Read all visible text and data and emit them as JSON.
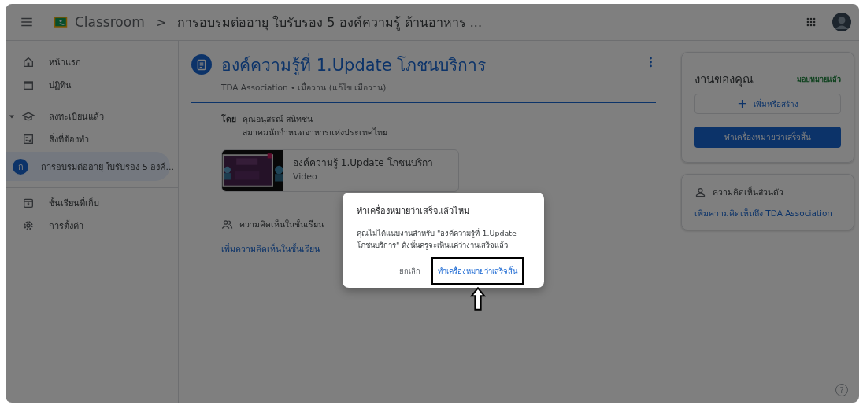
{
  "header": {
    "app_name": "Classroom",
    "separator": ">",
    "course_title": "การอบรมต่ออายุ ใบรับรอง 5 องค์ความรู้ ด้านอาหาร ..."
  },
  "sidebar": {
    "groups": [
      [
        {
          "kind": "home",
          "label": "หน้าแรก",
          "selected": false
        },
        {
          "kind": "calendar",
          "label": "ปฏิทิน",
          "selected": false
        }
      ],
      [
        {
          "kind": "enrolled",
          "label": "ลงทะเบียนแล้ว",
          "selected": false,
          "expanded": true
        },
        {
          "kind": "todo",
          "label": "สิ่งที่ต้องทำ",
          "selected": false
        },
        {
          "kind": "course",
          "label": "การอบรมต่ออายุ ใบรับรอง 5 องค์...",
          "letter": "ก",
          "selected": true
        }
      ],
      [
        {
          "kind": "archive",
          "label": "ชั้นเรียนที่เก็บ",
          "selected": false
        },
        {
          "kind": "settings",
          "label": "การตั้งค่า",
          "selected": false
        }
      ]
    ]
  },
  "post": {
    "title": "องค์ความรู้ที่ 1.Update โภชนบริการ",
    "meta": "TDA Association • เมื่อวาน (แก้ไข เมื่อวาน)",
    "author_label": "โดย",
    "author_name": "คุณอนุสรณ์ สนิทชน",
    "author_org": "สมาคมนักกำหนดอาหารแห่งประเทศไทย",
    "attachment": {
      "title": "องค์ความรู้ 1.Update โภชนบริกา",
      "type": "Video"
    },
    "class_comments": {
      "label": "ความคิดเห็นในชั้นเรียน",
      "link": "เพิ่มความคิดเห็นในชั้นเรียน"
    }
  },
  "your_work": {
    "title": "งานของคุณ",
    "status": "มอบหมายแล้ว",
    "add_icon": "+",
    "add_button": "เพิ่มหรือสร้าง",
    "done_button": "ทำเครื่องหมายว่าเสร็จสิ้น"
  },
  "private_comments": {
    "label": "ความคิดเห็นส่วนตัว",
    "link": "เพิ่มความคิดเห็นถึง TDA Association"
  },
  "help": "?",
  "dialog": {
    "title": "ทำเครื่องหมายว่าเสร็จแล้วไหม",
    "body": "คุณไม่ได้แนบงานสำหรับ \"องค์ความรู้ที่ 1.Update โภชนบริการ\" ดังนั้นครูจะเห็นแค่ว่างานเสร็จแล้ว",
    "buttons": [
      {
        "kind": "cancel",
        "label": "ยกเลิก",
        "highlighted": false
      },
      {
        "kind": "confirm",
        "label": "ทำเครื่องหมายว่าเสร็จสิ้น",
        "highlighted": true
      }
    ]
  }
}
